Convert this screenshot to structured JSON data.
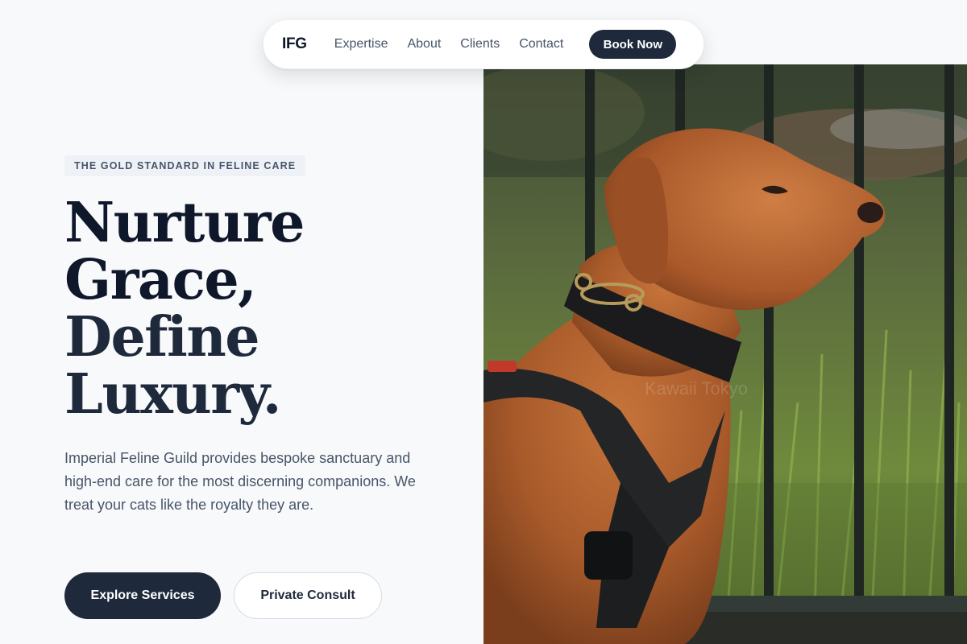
{
  "nav": {
    "logo": "IFG",
    "links": [
      "Expertise",
      "About",
      "Clients",
      "Contact"
    ],
    "cta": "Book Now"
  },
  "hero": {
    "badge": "THE GOLD STANDARD IN FELINE CARE",
    "headline": [
      "Nurture",
      "Grace,",
      "Define",
      "Luxury."
    ],
    "description": "Imperial Feline Guild provides bespoke sanctuary and high-end care for the most discerning companions. We treat your cats like the royalty they are.",
    "primary_button": "Explore Services",
    "secondary_button": "Private Consult"
  },
  "photo": {
    "subject": "dog-in-harness-photo"
  },
  "colors": {
    "background": "#f8f9fa",
    "primary": "#1e293b",
    "text_muted": "#475569"
  }
}
